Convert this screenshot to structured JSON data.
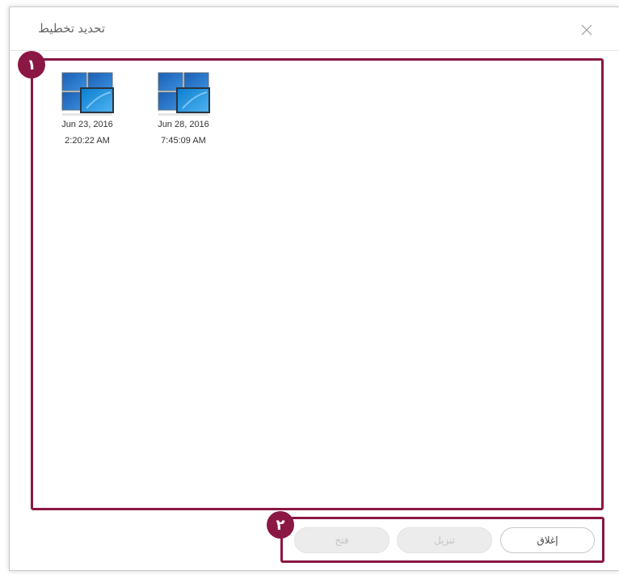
{
  "dialog": {
    "title": "تحديد تخطيط"
  },
  "callouts": [
    "١",
    "٢"
  ],
  "layouts": [
    {
      "date": "Jun 23, 2016",
      "time": "2:20:22 AM",
      "icon": "monitor-layout-icon"
    },
    {
      "date": "Jun 28, 2016",
      "time": "7:45:09 AM",
      "icon": "monitor-layout-icon"
    }
  ],
  "buttons": {
    "open_label": "فتح",
    "download_label": "تنزيل",
    "close_label": "إغلاق"
  },
  "colors": {
    "callout": "#8a1744",
    "disabled_button_bg": "#ececec",
    "disabled_button_text": "#c4c4c4",
    "title_text": "#666666"
  }
}
